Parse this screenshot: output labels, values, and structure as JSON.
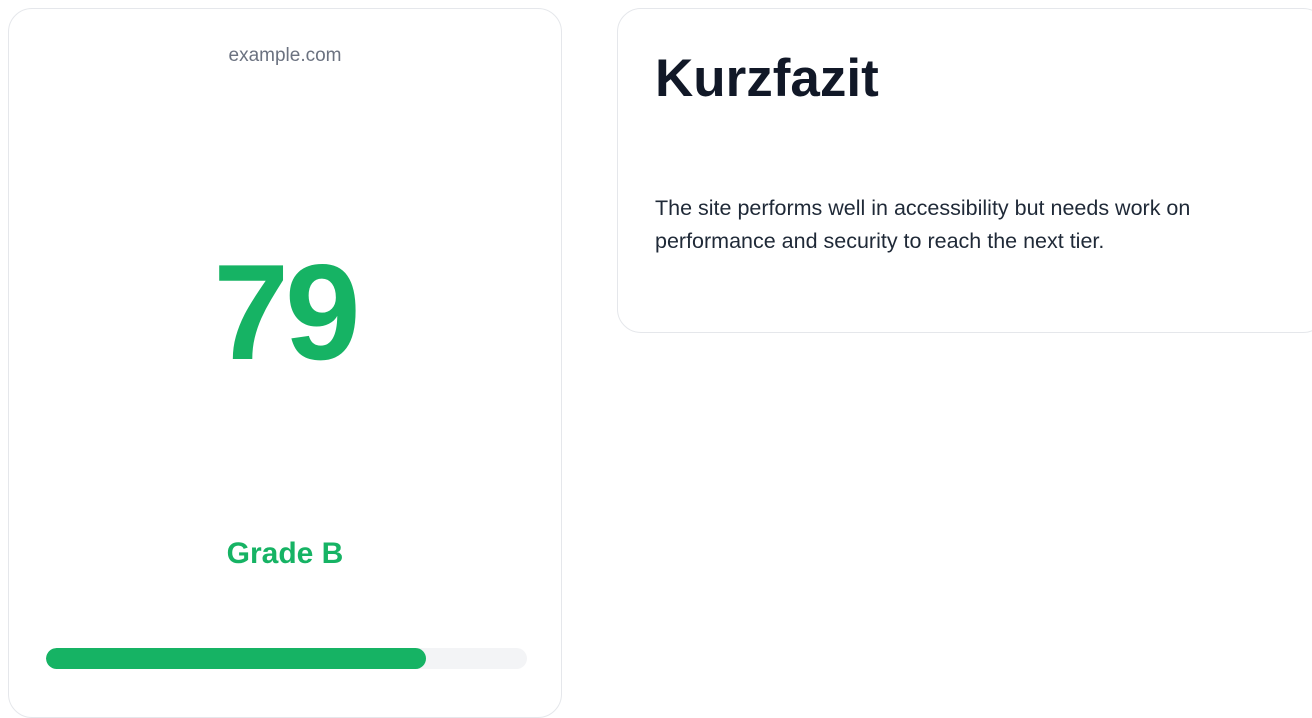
{
  "score_card": {
    "domain": "example.com",
    "score": "79",
    "grade": "Grade B",
    "progress_percent": 79
  },
  "summary_card": {
    "title": "Kurzfazit",
    "text": "The site performs well in accessibility but needs work on performance and security to reach the next tier."
  },
  "colors": {
    "accent": "#16b364",
    "title": "#111827",
    "muted": "#6b7280",
    "border": "#e5e7eb",
    "track": "#f3f4f6"
  }
}
